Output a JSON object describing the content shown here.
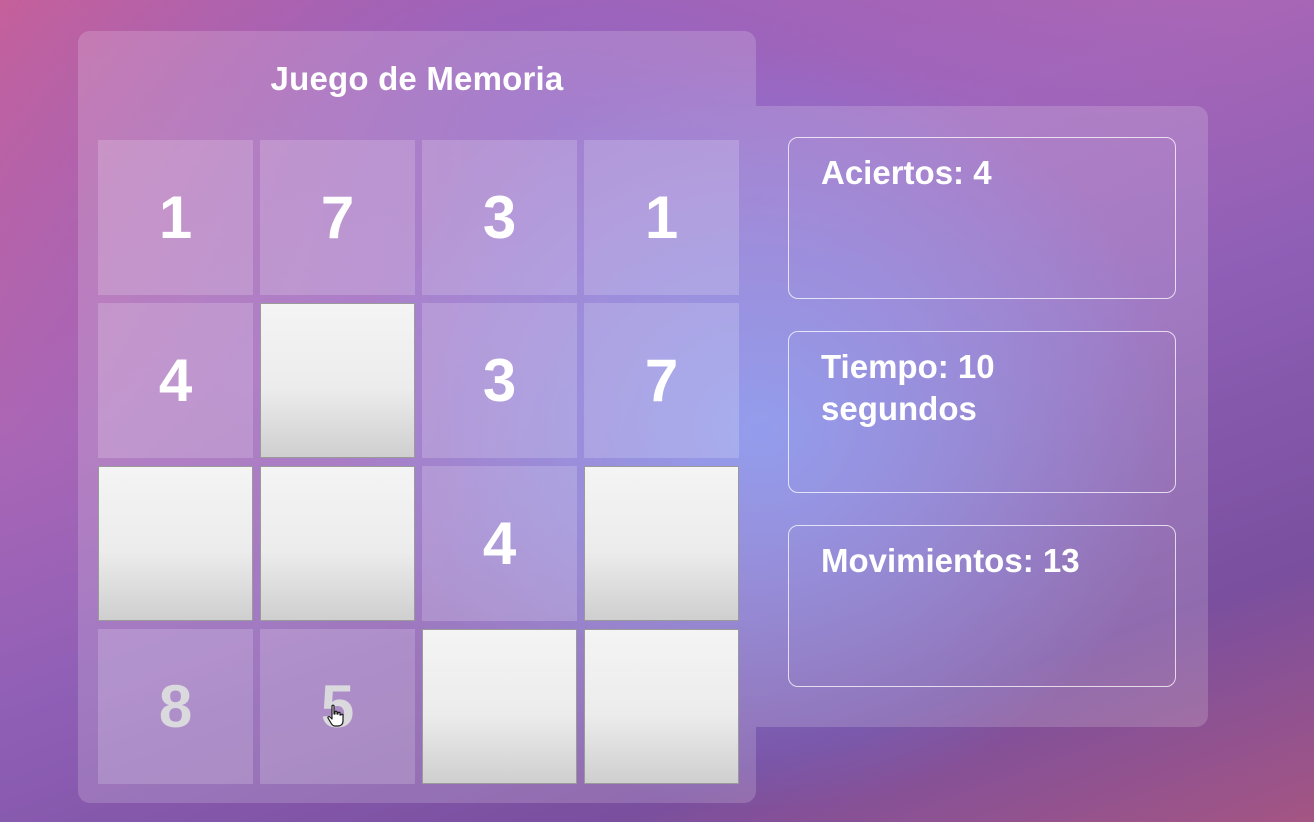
{
  "game": {
    "title": "Juego de Memoria"
  },
  "cards": [
    {
      "value": "1",
      "state": "revealed"
    },
    {
      "value": "7",
      "state": "revealed"
    },
    {
      "value": "3",
      "state": "revealed"
    },
    {
      "value": "1",
      "state": "revealed"
    },
    {
      "value": "4",
      "state": "revealed"
    },
    {
      "value": "",
      "state": "hidden"
    },
    {
      "value": "3",
      "state": "revealed"
    },
    {
      "value": "7",
      "state": "revealed"
    },
    {
      "value": "",
      "state": "hidden"
    },
    {
      "value": "",
      "state": "hidden"
    },
    {
      "value": "4",
      "state": "revealed"
    },
    {
      "value": "",
      "state": "hidden"
    },
    {
      "value": "8",
      "state": "revealed-dim"
    },
    {
      "value": "5",
      "state": "revealed-dim"
    },
    {
      "value": "",
      "state": "hidden"
    },
    {
      "value": "",
      "state": "hidden"
    }
  ],
  "stats": {
    "aciertos": "Aciertos: 4",
    "tiempo": "Tiempo: 10 segundos",
    "movimientos": "Movimientos: 13"
  },
  "cursor": {
    "icon": "hand-pointer-icon"
  },
  "colors": {
    "panel": "rgba(255,255,255,0.17)",
    "hidden_card": "#f0f0f0",
    "text": "#ffffff"
  }
}
